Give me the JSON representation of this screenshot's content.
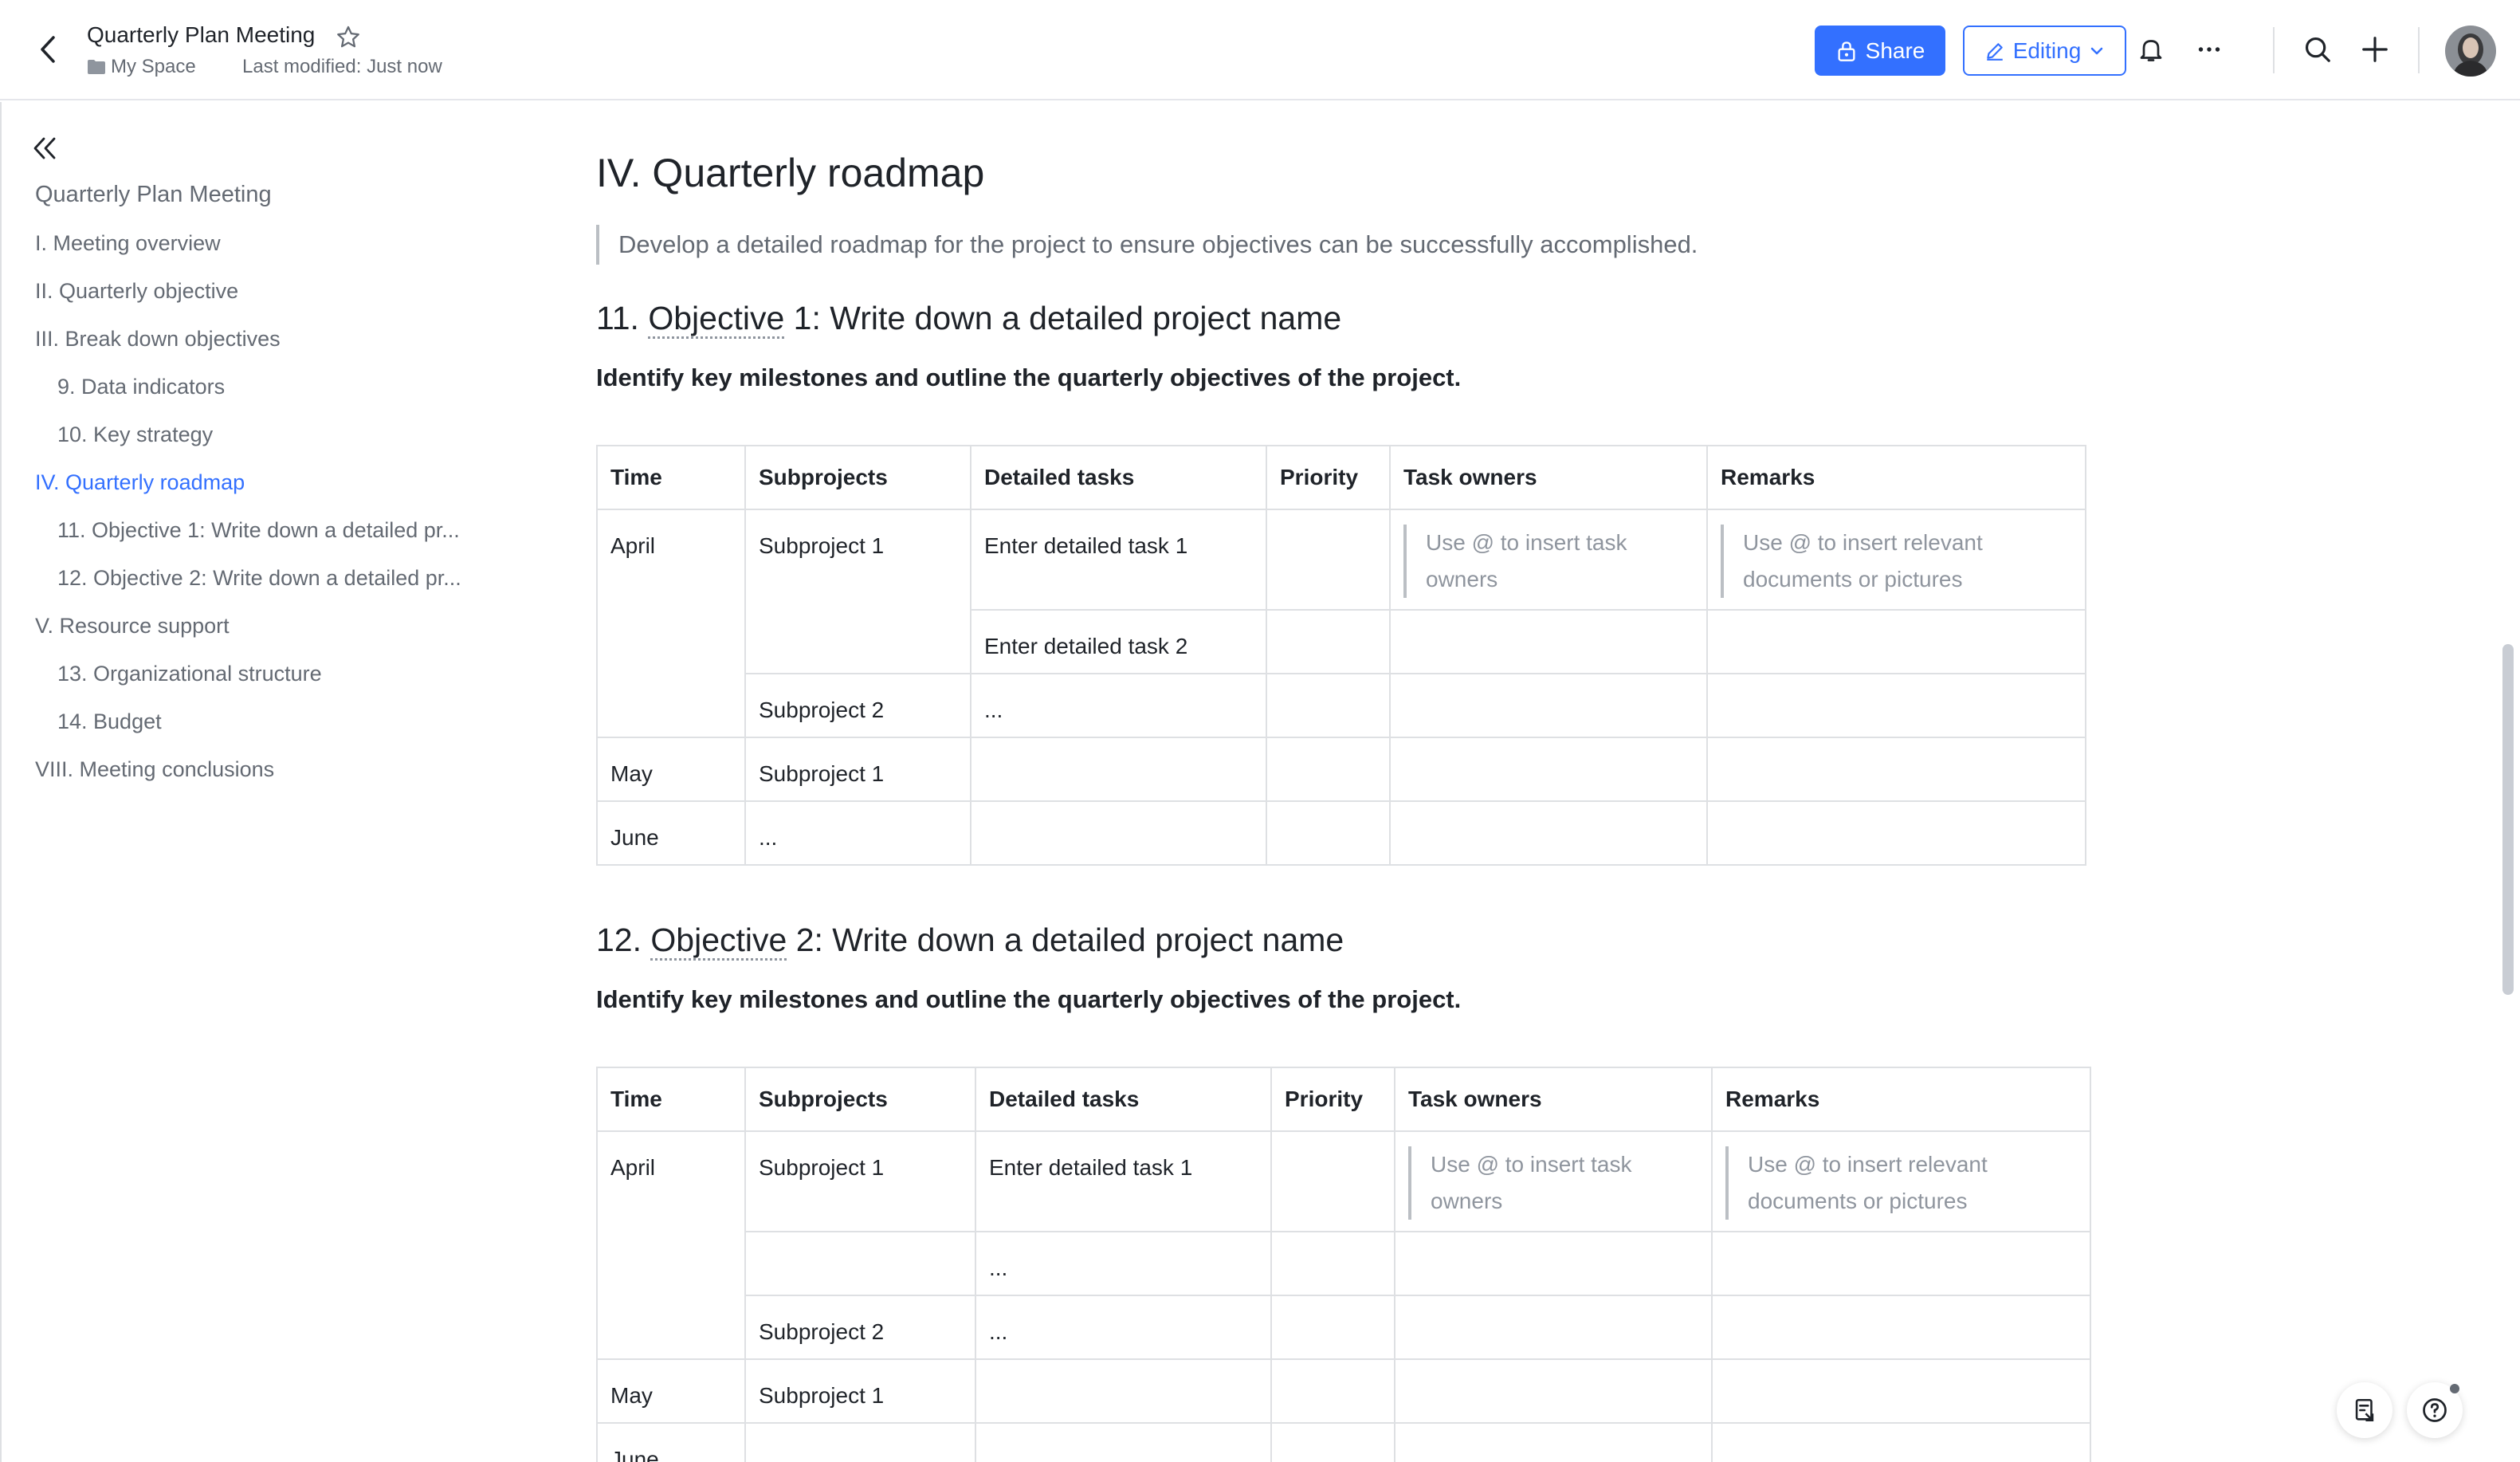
{
  "header": {
    "title": "Quarterly Plan Meeting",
    "breadcrumb": "My Space",
    "modified": "Last modified: Just now",
    "share_label": "Share",
    "editing_label": "Editing"
  },
  "sidebar": {
    "items": [
      {
        "label": "Quarterly Plan Meeting"
      },
      {
        "label": "I. Meeting overview"
      },
      {
        "label": "II. Quarterly objective"
      },
      {
        "label": "III. Break down objectives"
      },
      {
        "label": "9. Data indicators"
      },
      {
        "label": "10. Key strategy"
      },
      {
        "label": "IV. Quarterly roadmap"
      },
      {
        "label": "11. Objective 1: Write down a detailed pr..."
      },
      {
        "label": "12. Objective 2: Write down a detailed pr..."
      },
      {
        "label": "V. Resource support"
      },
      {
        "label": "13. Organizational structure"
      },
      {
        "label": "14. Budget"
      },
      {
        "label": "VIII. Meeting conclusions"
      }
    ]
  },
  "content": {
    "heading": "IV. Quarterly roadmap",
    "quote": "Develop a detailed roadmap for the project to ensure objectives can be successfully accomplished.",
    "sections": [
      {
        "num": "11.",
        "word": "Objective",
        "rest": " 1: Write down a detailed project name",
        "subtitle": "Identify key milestones and outline the quarterly objectives of the project."
      },
      {
        "num": "12.",
        "word": "Objective",
        "rest": " 2: Write down a detailed project name",
        "subtitle": "Identify key milestones and outline the quarterly objectives of the project."
      }
    ],
    "columns": [
      "Time",
      "Subprojects",
      "Detailed tasks",
      "Priority",
      "Task owners",
      "Remarks"
    ],
    "table1": {
      "april": "April",
      "sub1": "Subproject 1",
      "task1": "Enter detailed task 1",
      "owners_ph": "Use @ to insert task owners",
      "remarks_ph": "Use @ to insert relevant documents or pictures",
      "task2": "Enter detailed task 2",
      "sub2": "Subproject 2",
      "sub2_task": "...",
      "may": "May",
      "may_sub": "Subproject 1",
      "june": "June",
      "june_sub": "..."
    },
    "table2": {
      "april": "April",
      "sub1": "Subproject 1",
      "task1": "Enter detailed task 1",
      "owners_ph": "Use @ to insert task owners",
      "remarks_ph": "Use @ to insert relevant documents or pictures",
      "task2": "...",
      "sub2": "Subproject 2",
      "sub2_task": "...",
      "may": "May",
      "may_sub": "Subproject 1",
      "june": "June"
    }
  },
  "colors": {
    "accent": "#3370ff",
    "text": "#1f2329",
    "muted": "#646a73",
    "border": "#dee0e3"
  }
}
